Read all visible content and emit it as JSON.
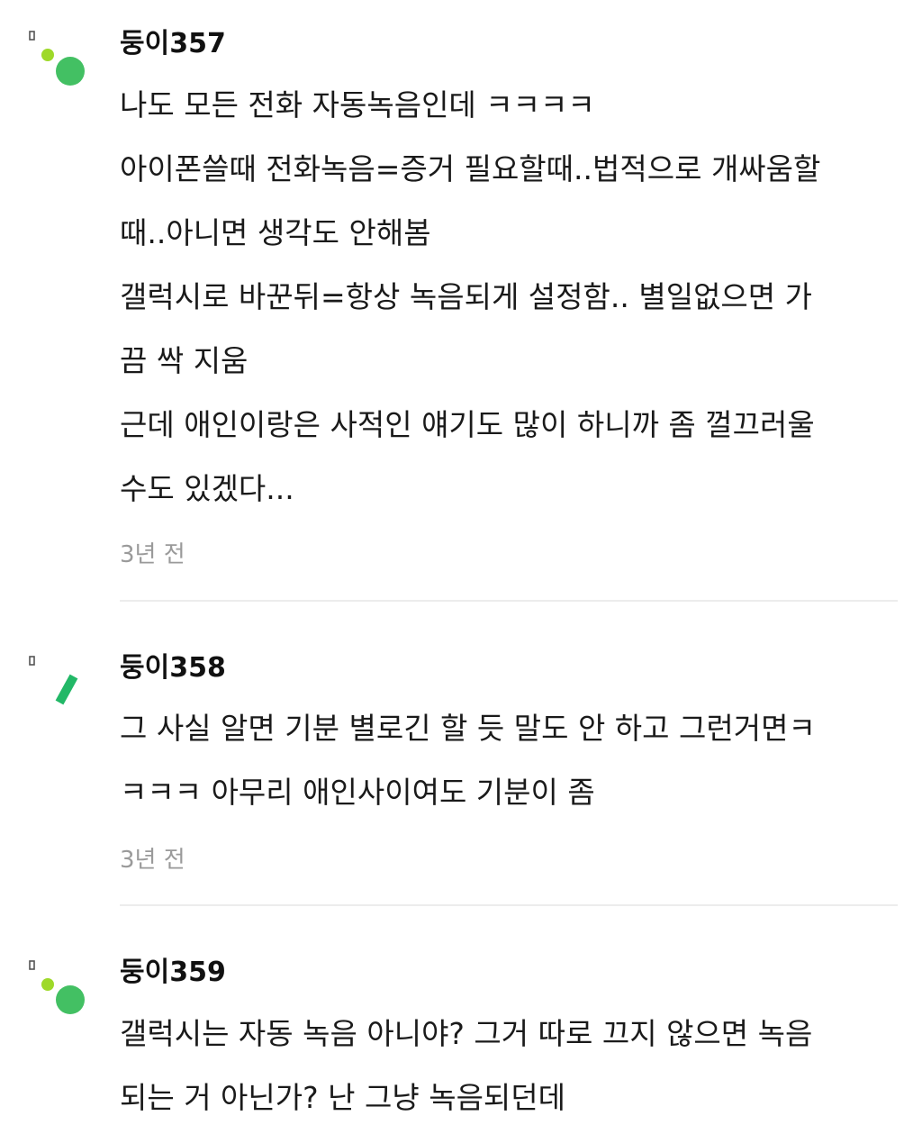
{
  "comments": [
    {
      "author": "둥이357",
      "avatar_icon": "dots-avatar-icon",
      "lines": [
        "나도 모든 전화 자동녹음인데 ㅋㅋㅋㅋ",
        "아이폰쓸때 전화녹음=증거 필요할때..법적으로 개싸움할",
        "때..아니면 생각도 안해봄",
        "갤럭시로 바꾼뒤=항상 녹음되게 설정함.. 별일없으면 가",
        "끔 싹 지움",
        "근데 애인이랑은 사적인 얘기도 많이 하니까 좀 껄끄러울",
        "수도 있겠다..."
      ],
      "time": "3년 전"
    },
    {
      "author": "둥이358",
      "avatar_icon": "slash-avatar-icon",
      "lines": [
        "그 사실 알면 기분 별로긴 할 듯 말도 안 하고 그런거면ㅋ",
        "ㅋㅋㅋ 아무리 애인사이여도 기분이 좀"
      ],
      "time": "3년 전"
    },
    {
      "author": "둥이359",
      "avatar_icon": "dots-avatar-icon",
      "lines": [
        "갤럭시는 자동 녹음 아니야? 그거 따로 끄지 않으면 녹음",
        "되는 거 아닌가? 난 그냥 녹음되던데"
      ],
      "time": ""
    }
  ],
  "colors": {
    "avatar_green": "#43c063",
    "avatar_lime": "#9ed929",
    "avatar_slash": "#22b867",
    "avatar_box": "#555555",
    "text": "#1a1a1a",
    "meta": "#9a9a9a",
    "divider": "#ececec"
  }
}
